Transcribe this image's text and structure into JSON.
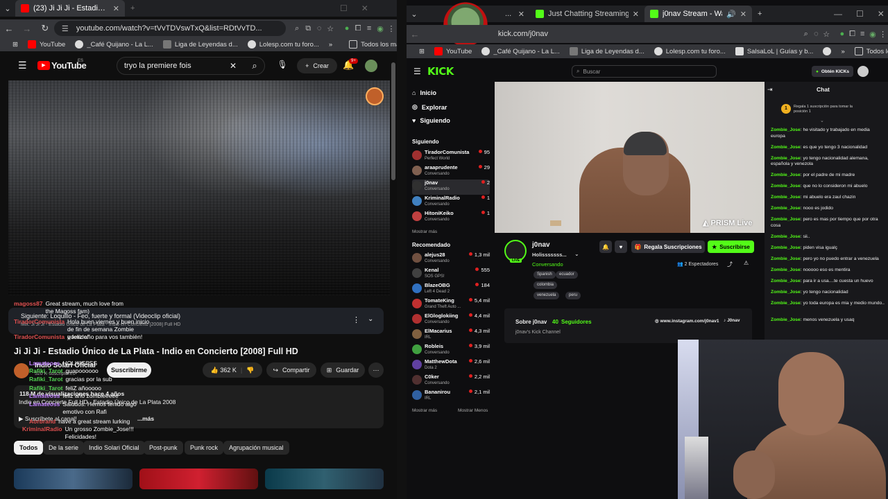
{
  "left": {
    "tabs": [
      {
        "label": "(23) Ji Ji Ji - Estadio Único de La..."
      }
    ],
    "url": "youtube.com/watch?v=tVvTDVswTxQ&list=RDtVvTD...",
    "bookmarks": [
      "YouTube",
      "_Café Quijano - La L...",
      "Liga de Leyendas d...",
      "Lolesp.com tu foro...",
      "»",
      "Todos los marcadores"
    ],
    "youtube": {
      "logo": "YouTube",
      "region": "ES",
      "search": "tryo la premiere fois",
      "create": "Crear",
      "notifications": "9+",
      "next_label": "Siguiente: Loquillo - Feo, fuerte y formal (Videoclip oficial)",
      "next_sub": "Mix: Ji Ji Ji - Estadio Único de La Plata - Indio en Concierto [2008] Full HD",
      "title": "Ji Ji Ji - Estadio Único de La Plata - Indio en Concierto [2008] Full HD",
      "channel": "Indio Solari Oficial",
      "subscribers": "520 K suscriptores",
      "subscribe": "Suscribirme",
      "likes": "362 K",
      "share": "Compartir",
      "save": "Guardar",
      "views": "118 M de visualizaciones  hace 4 años",
      "desc_line": "Indio en Concierto Full HD - Estadio Único de La Plata 2008",
      "desc_link": "▶ Suscríbete al canal!",
      "more": "...más",
      "chips": [
        "Todos",
        "De la serie",
        "Indio Solari Oficial",
        "Post-punk",
        "Punk rock",
        "Agrupación musical"
      ],
      "overlay_chat": [
        {
          "user": "magoss87",
          "text": "Great stream, much love from the Magoss fam)",
          "color": "#e05050"
        },
        {
          "user": "TiradorComunista",
          "text": "Hola buen viernes y buen inicio de fin de semana Zombie querido!",
          "color": "#e05050"
        },
        {
          "user": "TiradorComunista",
          "text": "y feliz año para vos también!",
          "color": "#e05050"
        },
        {
          "user": "Lamateoss",
          "text": "HOLIIIISSSS",
          "color": "#c080ff"
        },
        {
          "user": "Rafiki_Tarot",
          "text": "guapoooooo",
          "color": "#50d050"
        },
        {
          "user": "Rafiki_Tarot",
          "text": "gracias por la sub",
          "color": "#50d050"
        },
        {
          "user": "Rafiki_Tarot",
          "text": "feliZ añooooo",
          "color": "#50d050"
        },
        {
          "user": "Lamateoss",
          "text": "feliz año zombieeeee",
          "color": "#c080ff"
        },
        {
          "user": "Lamateoss",
          "text": "Saludos. Hemos tenido algo emotivo con Rafi",
          "color": "#c080ff"
        },
        {
          "user": "Aorbrand",
          "text": "have a great stream lurking",
          "color": "#e05050"
        },
        {
          "user": "KriminalRadio",
          "text": "Un grosso Zombie_Jose!!! Felicidades!",
          "color": "#e05050"
        }
      ]
    }
  },
  "right": {
    "tabs": [
      {
        "label": "..."
      },
      {
        "label": "Just Chatting Streaming - Live S..."
      },
      {
        "label": "j0nav Stream - Watch Live o..."
      }
    ],
    "url": "kick.com/j0nav",
    "bookmarks": [
      "YouTube",
      "_Café Quijano - La L...",
      "Liga de Leyendas d...",
      "Lolesp.com tu foro...",
      "SalsaLoL | Guías y b...",
      "»",
      "Todos los marcadores"
    ],
    "kick": {
      "logo": "KICK",
      "search_placeholder": "Buscar",
      "get_kicks": "Obtén KICKs",
      "nav": [
        "Inicio",
        "Explorar",
        "Siguiendo"
      ],
      "following_title": "Siguiendo",
      "following": [
        {
          "name": "TiradorComunista",
          "cat": "Perfect World",
          "count": "95",
          "color": "#a03030"
        },
        {
          "name": "araaprudente",
          "cat": "Conversando",
          "count": "29",
          "color": "#806050"
        },
        {
          "name": "j0nav",
          "cat": "Conversando",
          "count": "2",
          "color": "#303030"
        },
        {
          "name": "KriminalRadio",
          "cat": "Conversando",
          "count": "1",
          "color": "#4080c0"
        },
        {
          "name": "HitoniKeiko",
          "cat": "Conversando",
          "count": "1",
          "color": "#c04040"
        }
      ],
      "show_more": "Mostrar más",
      "recommended_title": "Recomendado",
      "recommended": [
        {
          "name": "alejus28",
          "cat": "Conversando",
          "count": "1,3 mil",
          "color": "#705040"
        },
        {
          "name": "Kenal",
          "cat": "SOS GPS!",
          "count": "555",
          "color": "#404040"
        },
        {
          "name": "BlazeOBG",
          "cat": "Left 4 Dead 2",
          "count": "184",
          "color": "#3070c0"
        },
        {
          "name": "TomateKing",
          "cat": "Grand Theft Auto ...",
          "count": "5,4 mil",
          "color": "#c03030"
        },
        {
          "name": "ElGloglokiing",
          "cat": "Conversando",
          "count": "4,4 mil",
          "color": "#b03030"
        },
        {
          "name": "ElMacarius",
          "cat": "IRL",
          "count": "4,3 mil",
          "color": "#806040"
        },
        {
          "name": "Robleis",
          "cat": "Conversando",
          "count": "3,9 mil",
          "color": "#40a040"
        },
        {
          "name": "MatthewDota",
          "cat": "Dota 2",
          "count": "2,6 mil",
          "color": "#6040a0"
        },
        {
          "name": "C0ker",
          "cat": "Conversando",
          "count": "2,2 mil",
          "color": "#503030"
        },
        {
          "name": "Bananirou",
          "cat": "IRL",
          "count": "2,1 mil",
          "color": "#3060a0"
        }
      ],
      "show_less": "Mostrar Menos",
      "watermark": "PRISM Live",
      "streamer": "j0nav",
      "followers_count": "40",
      "stream_title": "Holisssssss...",
      "category": "Conversando",
      "tags": [
        "Spanish",
        "ecuador",
        "colombia",
        "venezuela",
        "peru"
      ],
      "gift_subs": "Regala Suscripciones",
      "subscribe": "Suscribirse",
      "viewers": "2 Espectadores",
      "about_title": "Sobre j0nav",
      "followers_label": "Seguidores",
      "about_text": "j0nav's Kick Channel",
      "instagram": "www.instagram.com/j0nav1",
      "tiktok": "J0nav",
      "live_badge": "LIVE",
      "chat_title": "Chat",
      "gift_prompt": "Regala 1 suscripción para tomar la posición 1",
      "chat": [
        {
          "user": "Zombie_Jose",
          "text": "he visitado y trabajado en media europa"
        },
        {
          "user": "Zombie_Jose",
          "text": "es que yo tengo 3 nacionalidad"
        },
        {
          "user": "Zombie_Jose",
          "text": "yo tengo nacionalidad alemana, española y venezola"
        },
        {
          "user": "Zombie_Jose",
          "text": "por el padre de mi madre"
        },
        {
          "user": "Zombie_Jose",
          "text": "que no lo consideron mi abuelo"
        },
        {
          "user": "Zombie_Jose",
          "text": "mi abuelo era zaul chazin"
        },
        {
          "user": "Zombie_Jose",
          "text": "nooo es jodido"
        },
        {
          "user": "Zombie_Jose",
          "text": "pero es mas por tiempo que por otra cosa"
        },
        {
          "user": "Zombie_Jose",
          "text": "sii.."
        },
        {
          "user": "Zombie_Jose",
          "text": "piden visa igualç"
        },
        {
          "user": "Zombie_Jose",
          "text": "pero yo no puedo entrar a venezuela"
        },
        {
          "user": "Zombie_Jose",
          "text": "nooooo eso es mentira"
        },
        {
          "user": "Zombie_Jose",
          "text": "para ir a usa....te cuesta un huevo"
        },
        {
          "user": "Zombie_Jose",
          "text": "yo tengo nacionalidad"
        },
        {
          "user": "Zombie_Jose",
          "text": "yo toda europa es mia y medio mundo.."
        },
        {
          "user": "Zombie_Jose",
          "text": "menos venezuela y usaq"
        }
      ]
    }
  },
  "colors": {
    "kick_green": "#53fc18",
    "yt_red": "#ff0000",
    "chrome_dark": "#202124"
  }
}
